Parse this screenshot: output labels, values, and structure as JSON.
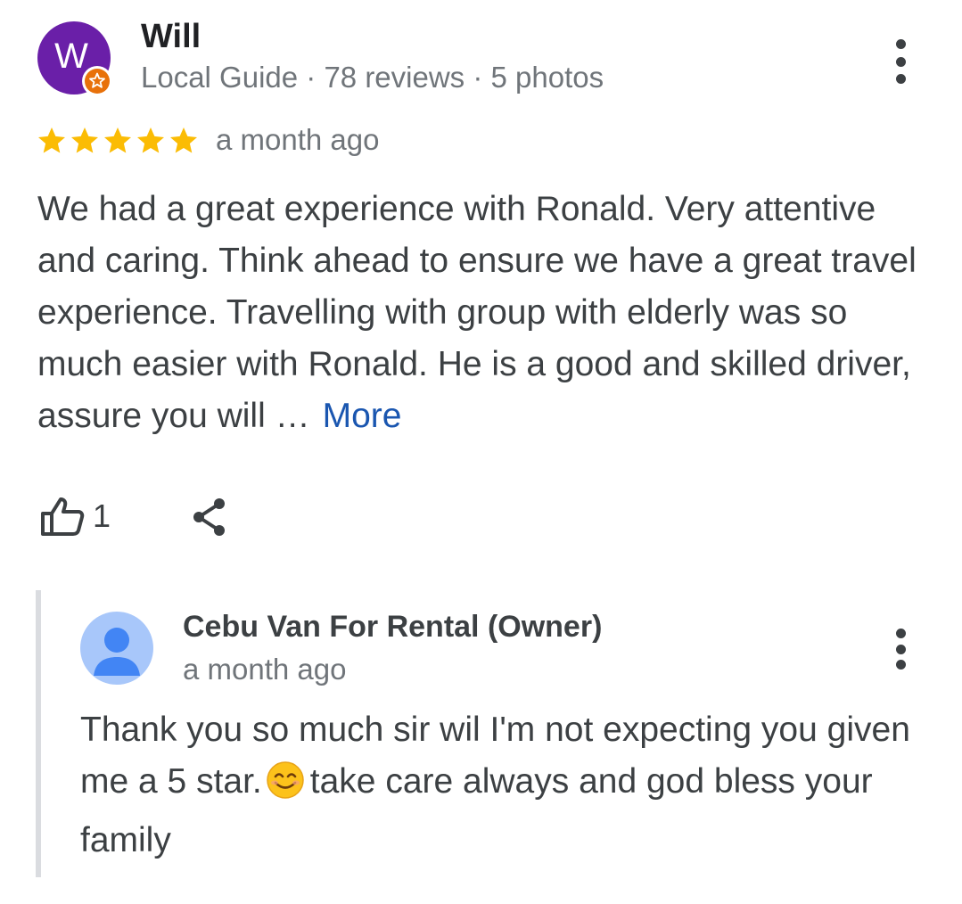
{
  "review": {
    "avatar_letter": "W",
    "avatar_color": "#6a1fa8",
    "badge_icon": "local-guide-star-icon",
    "badge_color": "#e8710a",
    "reviewer_name": "Will",
    "reviewer_meta": "Local Guide · 78 reviews · 5 photos",
    "rating": 5,
    "rating_max": 5,
    "star_color": "#fbbc04",
    "date": "a month ago",
    "text": "We had a great experience with Ronald. Very attentive and caring. Think ahead to ensure we have a great travel experience. Travelling with group with elderly was so much easier with Ronald. He is a good and skilled driver, assure you will …",
    "more_label": "More",
    "like_icon": "thumbs-up-icon",
    "like_count": "1",
    "share_icon": "share-icon",
    "menu_icon": "more-vert-icon"
  },
  "owner_reply": {
    "avatar_icon": "person-icon",
    "name": "Cebu Van For Rental (Owner)",
    "date": "a month ago",
    "text_before_emoji": "Thank you so much sir wil I'm not expecting you given me a 5 star.",
    "emoji_icon": "smiling-face-emoji",
    "text_after_emoji": "take care always and god bless your family",
    "menu_icon": "more-vert-icon"
  }
}
